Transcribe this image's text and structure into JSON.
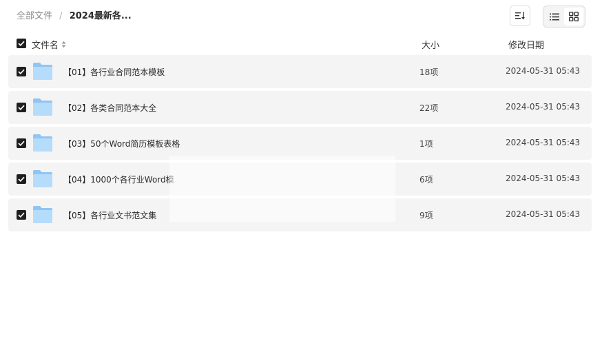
{
  "breadcrumb": {
    "root": "全部文件",
    "separator": "/",
    "current": "2024最新各..."
  },
  "toolbar": {
    "sort_icon": "sort-icon",
    "list_view_icon": "list-view-icon",
    "grid_view_icon": "grid-view-icon",
    "active_view": "grid"
  },
  "table": {
    "headers": {
      "name": "文件名",
      "size": "大小",
      "date": "修改日期"
    },
    "rows": [
      {
        "name": "【01】各行业合同范本模板",
        "size": "18项",
        "date": "2024-05-31 05:43",
        "checked": true
      },
      {
        "name": "【02】各类合同范本大全",
        "size": "22项",
        "date": "2024-05-31 05:43",
        "checked": true
      },
      {
        "name": "【03】50个Word简历模板表格",
        "size": "1项",
        "date": "2024-05-31 05:43",
        "checked": true
      },
      {
        "name": "【04】1000个各行业Word模",
        "size": "6项",
        "date": "2024-05-31 05:43",
        "checked": true
      },
      {
        "name": "【05】各行业文书范文集",
        "size": "9项",
        "date": "2024-05-31 05:43",
        "checked": true
      }
    ]
  },
  "colors": {
    "row_bg": "#f4f4f4",
    "checkbox": "#1f1f1f",
    "folder_top": "#8fc5f4",
    "folder_body": "#b6dcfb"
  }
}
